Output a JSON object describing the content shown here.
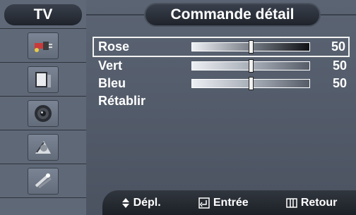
{
  "sidebar": {
    "header": "TV",
    "icons": [
      "input-icon",
      "picture-icon",
      "sound-icon",
      "channel-icon",
      "setup-icon"
    ]
  },
  "menu": {
    "title": "Commande détail",
    "items": [
      {
        "label": "Rose",
        "value": "50",
        "level": 0.5,
        "selected": true
      },
      {
        "label": "Vert",
        "value": "50",
        "level": 0.5,
        "selected": false
      },
      {
        "label": "Bleu",
        "value": "50",
        "level": 0.5,
        "selected": false
      },
      {
        "label": "Rétablir",
        "selected": false
      }
    ]
  },
  "bottom_bar": {
    "move_label": "Dépl.",
    "enter_label": "Entrée",
    "return_label": "Retour"
  }
}
